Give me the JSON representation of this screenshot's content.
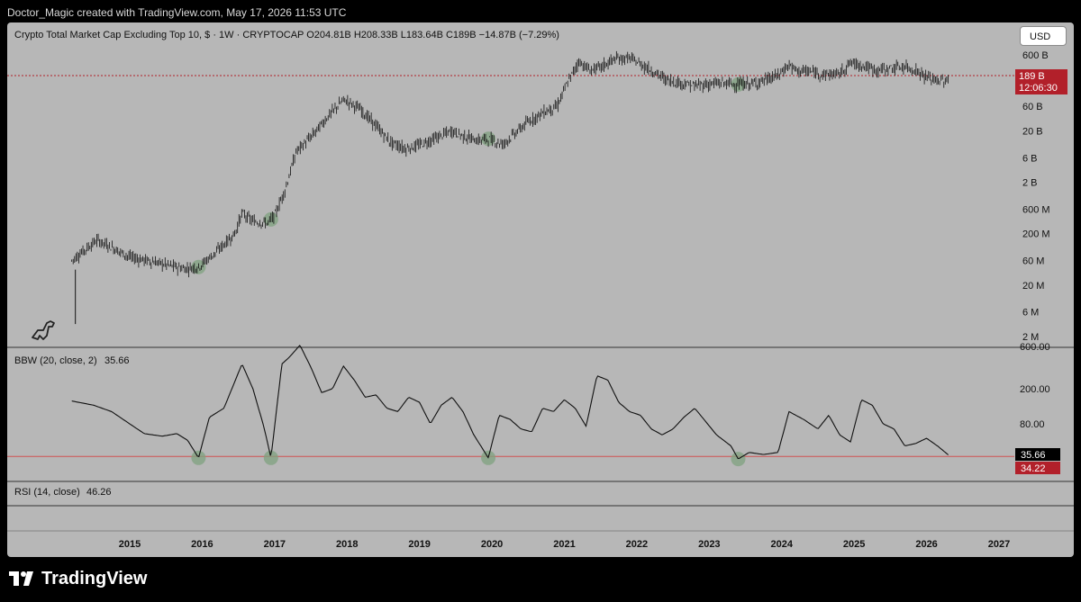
{
  "header": {
    "attribution": "Doctor_Magic created with TradingView.com, May 17, 2026 11:53 UTC"
  },
  "main_pane": {
    "legend": "Crypto Total Market Cap Excluding Top 10, $ · 1W · CRYPTOCAP  O204.81B  H208.33B  L183.64B  C189B  −14.87B (−7.29%)",
    "currency_button": "USD",
    "price_tag": {
      "value": "189 B",
      "countdown": "12:06:30",
      "color": "#b2202a"
    },
    "line_color": "#b2202a"
  },
  "bbw_pane": {
    "legend_name": "BBW (20, close, 2)",
    "legend_value": "35.66",
    "value_tag": "35.66",
    "level_tag": "34.22",
    "level_color": "#e05050",
    "tag_color_value": "#000000",
    "tag_color_level": "#b2202a"
  },
  "rsi_pane": {
    "legend_name": "RSI (14, close)",
    "legend_value": "46.26"
  },
  "chart_data": [
    {
      "type": "candlestick",
      "title": "Crypto Total Market Cap Excluding Top 10, $ · 1W · CRYPTOCAP",
      "scale": "log",
      "yticks": [
        "600 B",
        "60 B",
        "20 B",
        "6 B",
        "2 B",
        "600 M",
        "200 M",
        "60 M",
        "20 M",
        "6 M",
        "2 M"
      ],
      "ytick_values": [
        600000000000.0,
        60000000000.0,
        20000000000.0,
        6000000000.0,
        2000000000.0,
        600000000.0,
        200000000.0,
        60000000.0,
        20000000.0,
        6000000.0,
        2000000.0
      ],
      "xticks": [
        "2015",
        "2016",
        "2017",
        "2018",
        "2019",
        "2020",
        "2021",
        "2022",
        "2023",
        "2024",
        "2025",
        "2026",
        "2027"
      ],
      "series": [
        {
          "x": [
            2014.2,
            2014.35,
            2014.55,
            2014.75,
            2015.0,
            2015.25,
            2015.5,
            2015.75,
            2015.95,
            2016.2,
            2016.45,
            2016.55,
            2016.7,
            2016.9,
            2017.0,
            2017.15,
            2017.3,
            2017.5,
            2017.75,
            2017.95,
            2018.05,
            2018.2,
            2018.4,
            2018.6,
            2018.8,
            2018.95,
            2019.2,
            2019.45,
            2019.6,
            2019.8,
            2019.95,
            2020.15,
            2020.3,
            2020.5,
            2020.7,
            2020.9,
            2021.05,
            2021.2,
            2021.35,
            2021.5,
            2021.7,
            2021.9,
            2022.05,
            2022.2,
            2022.4,
            2022.6,
            2022.8,
            2022.95,
            2023.2,
            2023.4,
            2023.6,
            2023.8,
            2023.95,
            2024.1,
            2024.2,
            2024.4,
            2024.6,
            2024.8,
            2024.95,
            2025.1,
            2025.3,
            2025.5,
            2025.7,
            2025.85,
            2026.0,
            2026.15,
            2026.3
          ],
          "y": [
            60000000.0,
            90000000.0,
            150000000.0,
            110000000.0,
            70000000.0,
            60000000.0,
            50000000.0,
            42000000.0,
            45000000.0,
            90000000.0,
            200000000.0,
            500000000.0,
            350000000.0,
            320000000.0,
            450000000.0,
            1500000000.0,
            8000000000.0,
            15000000000.0,
            40000000000.0,
            80000000000.0,
            70000000000.0,
            50000000000.0,
            25000000000.0,
            12000000000.0,
            9000000000.0,
            10000000000.0,
            14000000000.0,
            20000000000.0,
            16000000000.0,
            13000000000.0,
            14000000000.0,
            11000000000.0,
            17000000000.0,
            30000000000.0,
            45000000000.0,
            60000000000.0,
            180000000000.0,
            450000000000.0,
            300000000000.0,
            350000000000.0,
            500000000000.0,
            520000000000.0,
            400000000000.0,
            300000000000.0,
            200000000000.0,
            170000000000.0,
            150000000000.0,
            160000000000.0,
            170000000000.0,
            160000000000.0,
            165000000000.0,
            200000000000.0,
            240000000000.0,
            380000000000.0,
            300000000000.0,
            280000000000.0,
            250000000000.0,
            260000000000.0,
            420000000000.0,
            380000000000.0,
            300000000000.0,
            330000000000.0,
            350000000000.0,
            300000000000.0,
            220000000000.0,
            190000000000.0,
            189000000000.0
          ]
        }
      ],
      "highlights_x": [
        2015.95,
        2016.95,
        2019.95,
        2023.4
      ],
      "current_value": 189000000000.0
    },
    {
      "type": "line",
      "title": "BBW (20, close, 2)",
      "scale": "log",
      "yticks": [
        "600.00",
        "200.00",
        "80.00"
      ],
      "ytick_values": [
        600,
        200,
        80
      ],
      "hline": 34.22,
      "series": [
        {
          "x": [
            2014.2,
            2014.5,
            2014.75,
            2015.0,
            2015.2,
            2015.45,
            2015.65,
            2015.8,
            2015.95,
            2016.1,
            2016.3,
            2016.55,
            2016.7,
            2016.85,
            2016.95,
            2017.1,
            2017.2,
            2017.35,
            2017.5,
            2017.65,
            2017.8,
            2017.95,
            2018.1,
            2018.25,
            2018.4,
            2018.55,
            2018.7,
            2018.85,
            2019.0,
            2019.15,
            2019.3,
            2019.45,
            2019.6,
            2019.75,
            2019.95,
            2020.1,
            2020.25,
            2020.4,
            2020.55,
            2020.7,
            2020.85,
            2021.0,
            2021.15,
            2021.3,
            2021.45,
            2021.6,
            2021.75,
            2021.9,
            2022.05,
            2022.2,
            2022.35,
            2022.5,
            2022.65,
            2022.8,
            2022.95,
            2023.1,
            2023.3,
            2023.4,
            2023.55,
            2023.75,
            2023.95,
            2024.1,
            2024.3,
            2024.5,
            2024.65,
            2024.8,
            2024.95,
            2025.1,
            2025.25,
            2025.4,
            2025.55,
            2025.7,
            2025.85,
            2026.0,
            2026.15,
            2026.3
          ],
          "y": [
            145,
            130,
            110,
            80,
            62,
            58,
            62,
            52,
            33,
            95,
            120,
            380,
            200,
            75,
            33,
            380,
            450,
            620,
            350,
            180,
            200,
            360,
            250,
            160,
            170,
            120,
            110,
            160,
            140,
            80,
            130,
            160,
            110,
            60,
            33,
            100,
            90,
            70,
            65,
            120,
            110,
            150,
            120,
            75,
            280,
            250,
            140,
            110,
            100,
            70,
            60,
            70,
            95,
            120,
            85,
            60,
            45,
            32,
            38,
            36,
            38,
            110,
            90,
            70,
            100,
            60,
            50,
            150,
            130,
            80,
            70,
            45,
            48,
            55,
            45,
            35.66
          ]
        }
      ],
      "current_value": 35.66,
      "highlights_x": [
        2015.95,
        2016.95,
        2019.95,
        2023.4
      ]
    },
    {
      "type": "line",
      "title": "RSI (14, close)",
      "series": []
    }
  ]
}
